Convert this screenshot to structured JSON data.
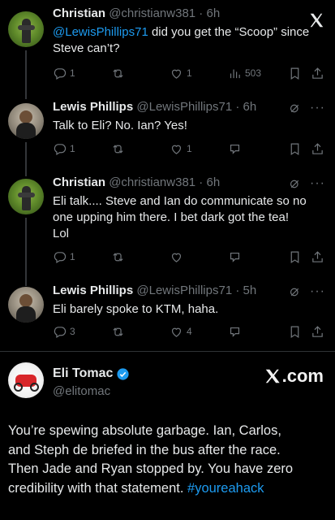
{
  "colors": {
    "background": "#000000",
    "text": "#e7e9ea",
    "muted": "#71767b",
    "link": "#1d9bf0"
  },
  "tweets": [
    {
      "name": "Christian",
      "handle": "@christianw381",
      "time": "6h",
      "mention": "@LewisPhillips71",
      "text_line1_rest": " did you get the “Scoop” since",
      "text_line2": "Steve can’t?",
      "replies": "1",
      "likes": "1",
      "views": "503"
    },
    {
      "name": "Lewis Phillips",
      "handle": "@LewisPhillips71",
      "time": "6h",
      "text_line1": "Talk to Eli? No. Ian? Yes!",
      "replies": "1",
      "likes": "1"
    },
    {
      "name": "Christian",
      "handle": "@christianw381",
      "time": "6h",
      "text_line1": "Eli talk.... Steve and Ian do communicate so no",
      "text_line2": "one upping him there. I bet dark got the tea!",
      "text_line3": "Lol",
      "replies": "1"
    },
    {
      "name": "Lewis Phillips",
      "handle": "@LewisPhillips71",
      "time": "5h",
      "text_line1": "Eli barely spoke to KTM, haha.",
      "replies": "3",
      "likes": "4"
    }
  ],
  "quote": {
    "name": "Eli Tomac",
    "handle": "@elitomac",
    "brand": ".com",
    "line1": "You’re spewing absolute garbage. Ian, Carlos,",
    "line2": "and Steph de briefed in the bus after the race.",
    "line3": "Then Jade and Ryan stopped by. You have zero",
    "line4_text": "credibility with that statement. ",
    "hashtag": "#youreahack"
  },
  "icons": [
    "x-logo",
    "reply-icon",
    "retweet-icon",
    "like-icon",
    "views-icon",
    "bookmark-icon",
    "share-icon",
    "grok-icon",
    "more-icon",
    "verified-icon"
  ]
}
